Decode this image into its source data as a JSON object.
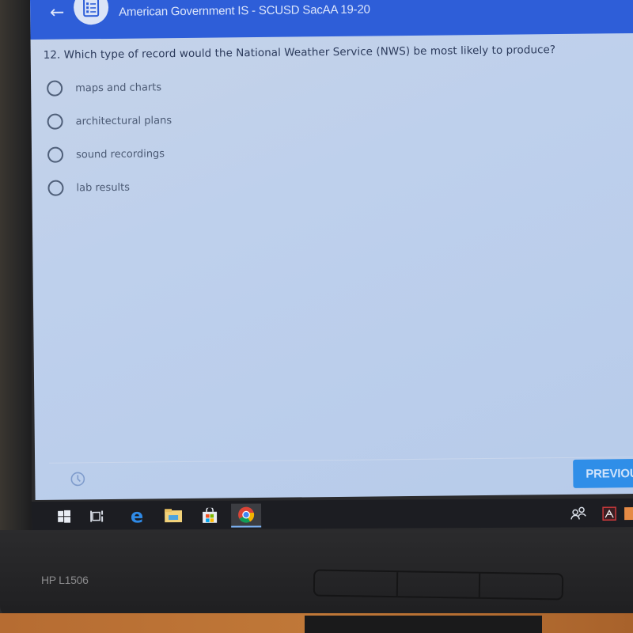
{
  "header": {
    "subtitle": "American Government IS - SCUSD SacAA 19-20",
    "back_icon": "arrow-left-icon",
    "assignment_icon": "assignment-list-icon"
  },
  "question": {
    "text": "12. Which type of record would the National Weather Service (NWS) be most likely to produce?",
    "options": [
      {
        "label": "maps and charts",
        "selected": false
      },
      {
        "label": "architectural plans",
        "selected": false
      },
      {
        "label": "sound recordings",
        "selected": false
      },
      {
        "label": "lab results",
        "selected": false
      }
    ]
  },
  "footer": {
    "timer_icon": "clock-icon",
    "previous_label": "PREVIOUS"
  },
  "taskbar": {
    "items": [
      {
        "name": "windows-start",
        "icon": "windows-icon"
      },
      {
        "name": "task-view",
        "icon": "task-view-icon"
      },
      {
        "name": "edge",
        "icon": "edge-icon"
      },
      {
        "name": "file-explorer",
        "icon": "folder-icon"
      },
      {
        "name": "store",
        "icon": "store-icon"
      },
      {
        "name": "chrome",
        "icon": "chrome-icon",
        "active": true
      }
    ],
    "tray": [
      {
        "name": "people",
        "icon": "people-icon"
      },
      {
        "name": "adobe",
        "icon": "adobe-icon"
      }
    ]
  },
  "monitor": {
    "model": "HP L1506"
  },
  "colors": {
    "header_bg": "#2e5ed8",
    "screen_bg": "#bed0ec",
    "primary_button": "#2f8ee8",
    "taskbar_bg": "#1c1d22"
  }
}
